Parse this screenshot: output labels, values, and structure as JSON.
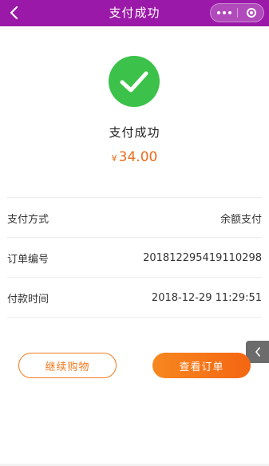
{
  "nav": {
    "title": "支付成功",
    "bg_color": "#9b19a8",
    "back_icon": "chevron-left-icon",
    "more_icon": "more-dots-icon",
    "close_icon": "target-close-icon"
  },
  "result": {
    "icon": "check-circle-icon",
    "icon_color": "#3cc24a",
    "status_text": "支付成功",
    "currency_symbol": "¥",
    "amount": "34.00",
    "accent_color": "#e96b1b"
  },
  "details": [
    {
      "label": "支付方式",
      "value": "余额支付"
    },
    {
      "label": "订单编号",
      "value": "201812295419110298"
    },
    {
      "label": "付款时间",
      "value": "2018-12-29 11:29:51"
    }
  ],
  "actions": {
    "continue_label": "继续购物",
    "view_order_label": "查看订单"
  },
  "side_tab": {
    "icon": "chevron-left-icon"
  }
}
